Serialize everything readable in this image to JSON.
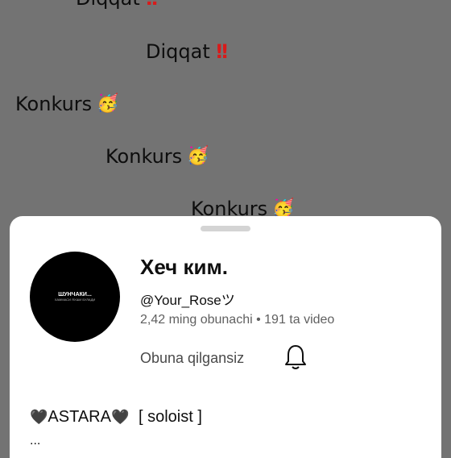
{
  "background": {
    "lines": [
      {
        "text": "Diqqat",
        "icon": "double-exclamation"
      },
      {
        "text": "Diqqat",
        "icon": "double-exclamation"
      },
      {
        "text": "Konkurs",
        "icon": "party-face-emoji"
      },
      {
        "text": "Konkurs",
        "icon": "party-face-emoji"
      },
      {
        "text": "Konkurs",
        "icon": "party-face-emoji"
      }
    ]
  },
  "channel": {
    "name": "Хеч ким.",
    "handle": "@Your_Roseツ",
    "stats": "2,42 ming obunachi • 191 ta video",
    "subscribe_label": "Obuna qilgansiz",
    "bell_icon": "bell-icon",
    "avatar_text_main": "ШУНЧАКИ...",
    "avatar_text_sub": "ХАММАСИ ЯХШИ БУЛАДИ",
    "description_name": "ASTARA",
    "description_tag": "[ soloist ]",
    "description_more": "..."
  },
  "colors": {
    "overlay": "#737373",
    "sheet": "#ffffff",
    "exclamation": "#d81b1b"
  }
}
